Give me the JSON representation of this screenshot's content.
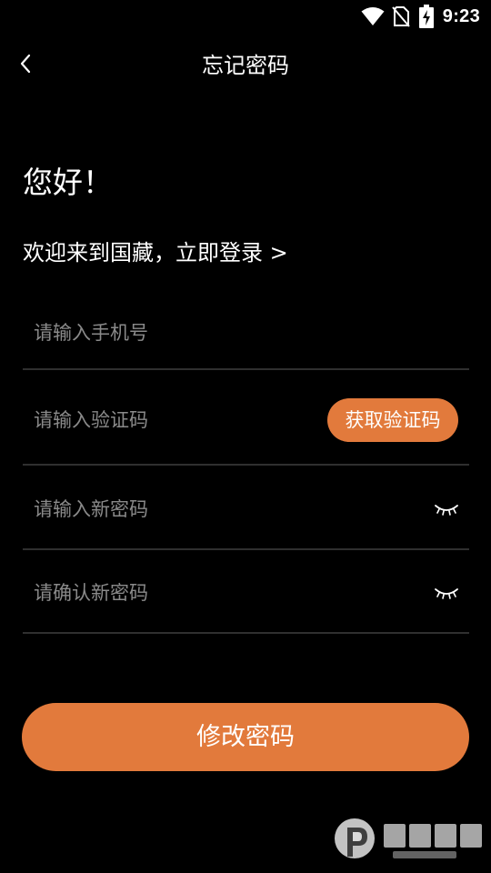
{
  "status_bar": {
    "time": "9:23",
    "icons": [
      "wifi-icon",
      "no-sim-icon",
      "battery-charging-icon"
    ]
  },
  "header": {
    "back_icon": "chevron-left-icon",
    "title": "忘记密码"
  },
  "greeting": "您好！",
  "subtitle": "欢迎来到国藏，立即登录 >",
  "form": {
    "phone": {
      "placeholder": "请输入手机号",
      "value": ""
    },
    "code": {
      "placeholder": "请输入验证码",
      "value": "",
      "button_label": "获取验证码"
    },
    "new_password": {
      "placeholder": "请输入新密码",
      "value": "",
      "toggle_icon": "eye-closed-icon"
    },
    "confirm_password": {
      "placeholder": "请确认新密码",
      "value": "",
      "toggle_icon": "eye-closed-icon"
    }
  },
  "submit_label": "修改密码",
  "colors": {
    "background": "#000000",
    "accent": "#e27a3c",
    "divider": "#2f2f2f",
    "placeholder": "#8a8a8a",
    "text": "#ffffff"
  }
}
